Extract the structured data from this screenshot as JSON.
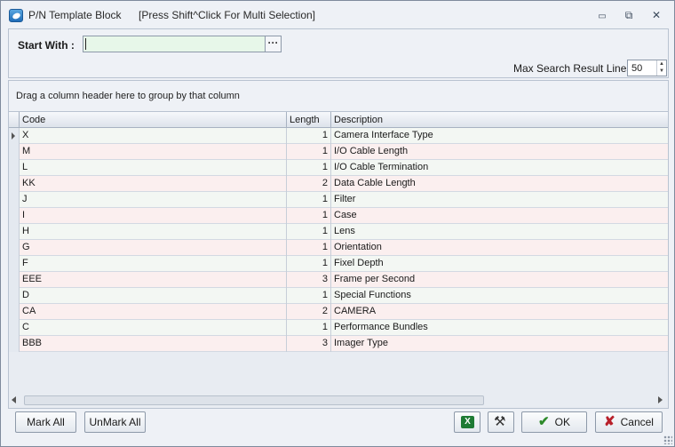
{
  "window": {
    "title": "P/N Template Block",
    "hint": "[Press Shift^Click For Multi Selection]",
    "controls": {
      "minimize": "▭",
      "restore": "⧉",
      "close": "✕"
    }
  },
  "search": {
    "start_label": "Start With :",
    "value": "",
    "browse_label": "···",
    "max_label": "Max Search Result Lines :",
    "max_value": "50"
  },
  "grid": {
    "group_hint": "Drag a column header here to group by that column",
    "columns": [
      "Code",
      "Length",
      "Description"
    ],
    "rows": [
      {
        "code": "X",
        "length": "1",
        "description": "Camera Interface Type"
      },
      {
        "code": "M",
        "length": "1",
        "description": "I/O Cable Length"
      },
      {
        "code": "L",
        "length": "1",
        "description": "I/O Cable Termination"
      },
      {
        "code": "KK",
        "length": "2",
        "description": "Data Cable Length"
      },
      {
        "code": "J",
        "length": "1",
        "description": "Filter"
      },
      {
        "code": "I",
        "length": "1",
        "description": "Case"
      },
      {
        "code": "H",
        "length": "1",
        "description": "Lens"
      },
      {
        "code": "G",
        "length": "1",
        "description": "Orientation"
      },
      {
        "code": "F",
        "length": "1",
        "description": "Fixel Depth"
      },
      {
        "code": "EEE",
        "length": "3",
        "description": "Frame per Second"
      },
      {
        "code": "D",
        "length": "1",
        "description": "Special Functions"
      },
      {
        "code": "CA",
        "length": "2",
        "description": "CAMERA"
      },
      {
        "code": "C",
        "length": "1",
        "description": "Performance Bundles"
      },
      {
        "code": "BBB",
        "length": "3",
        "description": "Imager Type"
      }
    ]
  },
  "buttons": {
    "mark_all": "Mark All",
    "unmark_all": "UnMark All",
    "ok": "OK",
    "cancel": "Cancel",
    "excel_icon": "excel-icon",
    "tools_icon": "tools-icon"
  },
  "colors": {
    "row_even": "#f3f7f3",
    "row_odd": "#fbefef",
    "input_bg": "#e7f7e9",
    "ok_check": "#2d8a2a",
    "cancel_x": "#b8202a"
  }
}
